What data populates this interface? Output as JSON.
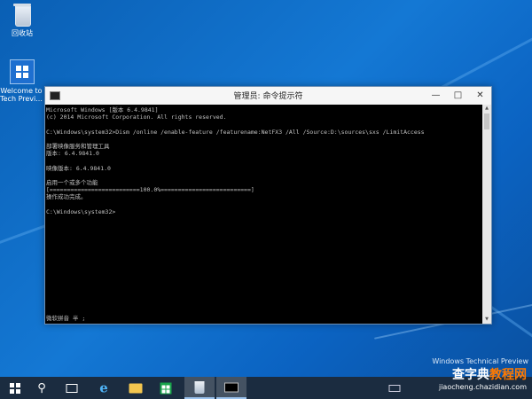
{
  "desktop": {
    "icons": [
      {
        "label": "回收站",
        "icon": "recycle-bin-icon"
      },
      {
        "label": "Welcome to Tech Previ...",
        "icon": "windows-tile-icon"
      }
    ],
    "watermark": "Windows Technical Preview"
  },
  "window": {
    "title": "管理员: 命令提示符",
    "app_icon": "console-icon",
    "buttons": {
      "minimize": "—",
      "maximize": "□",
      "close": "✕"
    },
    "console_lines": [
      "Microsoft Windows [版本 6.4.9841]",
      "(c) 2014 Microsoft Corporation. All rights reserved.",
      "",
      "C:\\Windows\\system32>Dism /online /enable-feature /featurename:NetFX3 /All /Source:D:\\sources\\sxs /LimitAccess",
      "",
      "部署映像服务和管理工具",
      "版本: 6.4.9841.0",
      "",
      "映像版本: 6.4.9841.0",
      "",
      "启用一个或多个功能",
      "[==========================100.0%==========================]",
      "操作成功完成。",
      "",
      "C:\\Windows\\system32>"
    ],
    "ime_status": "微软拼音 半 ;"
  },
  "taskbar": {
    "items": [
      {
        "name": "start",
        "icon": "windows-start-icon"
      },
      {
        "name": "search",
        "icon": "search-icon"
      },
      {
        "name": "task-view",
        "icon": "task-view-icon"
      },
      {
        "name": "internet-explorer",
        "icon": "internet-explorer-icon",
        "glyph": "e"
      },
      {
        "name": "file-explorer",
        "icon": "folder-icon"
      },
      {
        "name": "store",
        "icon": "store-icon"
      },
      {
        "name": "recycle-bin",
        "icon": "recycle-bin-icon"
      },
      {
        "name": "command-prompt",
        "icon": "command-prompt-icon"
      },
      {
        "name": "keyboard",
        "icon": "keyboard-icon"
      }
    ],
    "search_glyph": "⚲"
  },
  "site_watermark": {
    "brand_main": "查字典",
    "brand_accent": "教程网",
    "url": "jiaocheng.chazidian.com"
  }
}
